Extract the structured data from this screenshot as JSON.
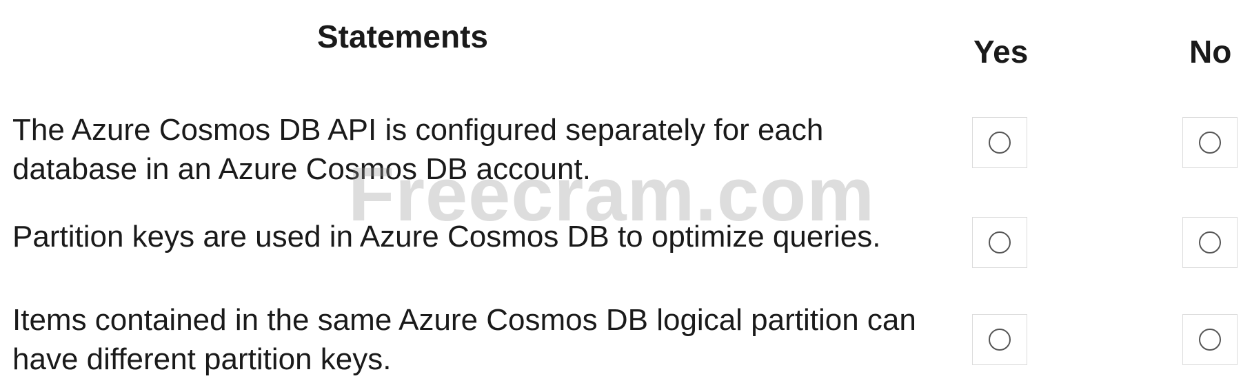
{
  "headers": {
    "statements": "Statements",
    "yes": "Yes",
    "no": "No"
  },
  "statements": [
    {
      "text": "The Azure Cosmos DB API is configured separately for each database in an Azure Cosmos DB account.",
      "yes_selected": false,
      "no_selected": false
    },
    {
      "text": "Partition keys are used in Azure Cosmos DB to optimize queries.",
      "yes_selected": false,
      "no_selected": false
    },
    {
      "text": "Items contained in the same Azure Cosmos DB logical partition can have different partition keys.",
      "yes_selected": false,
      "no_selected": false
    }
  ],
  "watermark": "Freecram.com"
}
